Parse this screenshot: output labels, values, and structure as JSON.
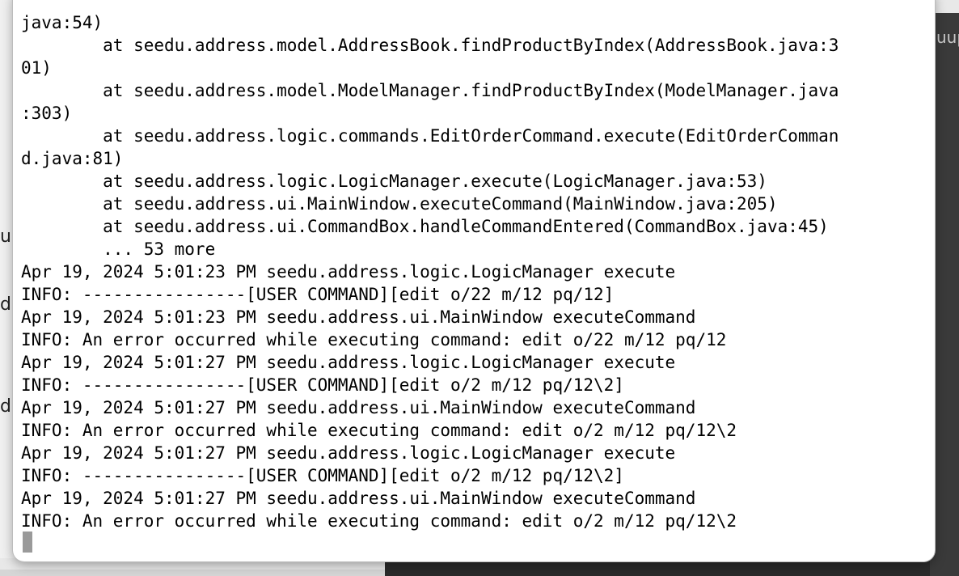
{
  "background": {
    "right_partial_text": "uup",
    "left_partial_letters": [
      "u",
      "d",
      "d"
    ]
  },
  "terminal": {
    "lines": [
      "java:54)",
      "        at seedu.address.model.AddressBook.findProductByIndex(AddressBook.java:3",
      "01)",
      "        at seedu.address.model.ModelManager.findProductByIndex(ModelManager.java",
      ":303)",
      "        at seedu.address.logic.commands.EditOrderCommand.execute(EditOrderComman",
      "d.java:81)",
      "        at seedu.address.logic.LogicManager.execute(LogicManager.java:53)",
      "        at seedu.address.ui.MainWindow.executeCommand(MainWindow.java:205)",
      "        at seedu.address.ui.CommandBox.handleCommandEntered(CommandBox.java:45)",
      "        ... 53 more",
      "Apr 19, 2024 5:01:23 PM seedu.address.logic.LogicManager execute",
      "INFO: ----------------[USER COMMAND][edit o/22 m/12 pq/12]",
      "Apr 19, 2024 5:01:23 PM seedu.address.ui.MainWindow executeCommand",
      "INFO: An error occurred while executing command: edit o/22 m/12 pq/12",
      "Apr 19, 2024 5:01:27 PM seedu.address.logic.LogicManager execute",
      "INFO: ----------------[USER COMMAND][edit o/2 m/12 pq/12\\2]",
      "Apr 19, 2024 5:01:27 PM seedu.address.ui.MainWindow executeCommand",
      "INFO: An error occurred while executing command: edit o/2 m/12 pq/12\\2",
      "Apr 19, 2024 5:01:27 PM seedu.address.logic.LogicManager execute",
      "INFO: ----------------[USER COMMAND][edit o/2 m/12 pq/12\\2]",
      "Apr 19, 2024 5:01:27 PM seedu.address.ui.MainWindow executeCommand",
      "INFO: An error occurred while executing command: edit o/2 m/12 pq/12\\2"
    ]
  }
}
